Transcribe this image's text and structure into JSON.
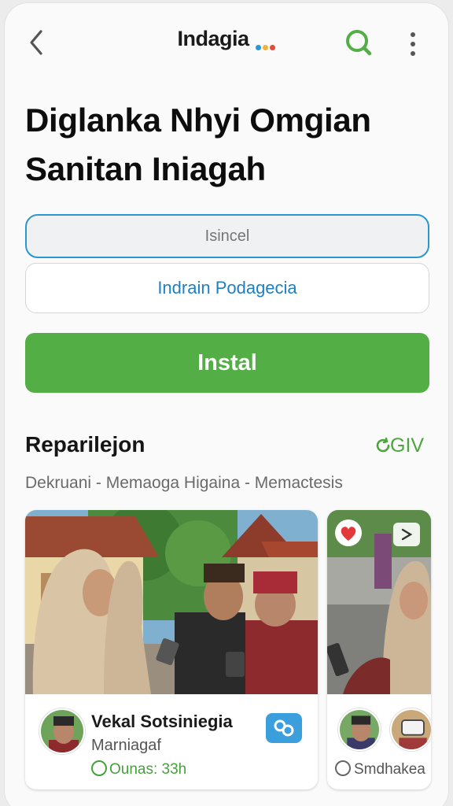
{
  "header": {
    "app_name": "Indagia",
    "logo_dot_colors": [
      "#2a97d3",
      "#f2b233",
      "#e44b3a"
    ],
    "back_icon": "chevron-left-icon",
    "search_icon": "search-icon",
    "more_icon": "more-vertical-icon"
  },
  "page": {
    "title_line1": "Diglanka Nhyi Omgian",
    "title_line2": "Sanitan Iniagah"
  },
  "form": {
    "field1_placeholder": "Isincel",
    "field2_label": "Indrain Podagecia",
    "install_label": "Instal"
  },
  "section": {
    "title": "Reparilejon",
    "link": "GIV",
    "breadcrumb": "Dekruani - Memaoga Higaina - Memactesis"
  },
  "cards": [
    {
      "title": "Vekal Sotsiniegia",
      "subtitle": "Marniagaf",
      "meta": "Ounas: 33h",
      "meta_icon": "clock-icon",
      "action_icon": "link-icon"
    },
    {
      "meta": "Smdhakea",
      "meta_icon": "chat-icon",
      "favorite_icon": "heart-icon",
      "share_icon": "share-icon"
    }
  ],
  "colors": {
    "accent_green": "#52ae45",
    "accent_blue": "#2a97d3",
    "heart_red": "#e23a3a"
  }
}
